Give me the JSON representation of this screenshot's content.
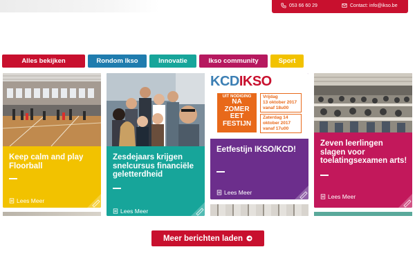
{
  "contact": {
    "phone": "053 66 60 29",
    "email_label": "Contact: info@ikso.be"
  },
  "filters": [
    {
      "label": "Alles bekijken",
      "color": "#c8102e"
    },
    {
      "label": "Rondom Ikso",
      "color": "#1f7cae"
    },
    {
      "label": "Innovatie",
      "color": "#17a59a"
    },
    {
      "label": "Ikso community",
      "color": "#b6195f"
    },
    {
      "label": "Sport",
      "color": "#f2c200"
    }
  ],
  "cards": [
    {
      "title": "Keep calm and play Floorball",
      "read_more": "Lees Meer",
      "color": "#f2c200"
    },
    {
      "title": "Zesdejaars krijgen snelcursus financiële geletterdheid",
      "read_more": "Lees Meer",
      "color": "#17a59a"
    },
    {
      "title": "Eetfestijn IKSO/KCD!",
      "read_more": "Lees Meer",
      "color": "#6c2e8c",
      "poster": {
        "brand_kcd": "KCD",
        "brand_ikso": "IKSO",
        "invite_small": "UIT NODIGING",
        "invite_big": [
          "NA",
          "ZOMER",
          "EET",
          "FESTIJN"
        ],
        "date1": [
          "Vrijdag",
          "13 oktober 2017",
          "vanaf 18u00"
        ],
        "date2": [
          "Zaterdag 14",
          "oktober 2017",
          "vanaf 17u00"
        ]
      }
    },
    {
      "title": "Zeven leerlingen slagen voor toelatingsexamen arts!",
      "read_more": "Lees Meer",
      "color": "#c2185b"
    }
  ],
  "load_more": "Meer berichten laden"
}
